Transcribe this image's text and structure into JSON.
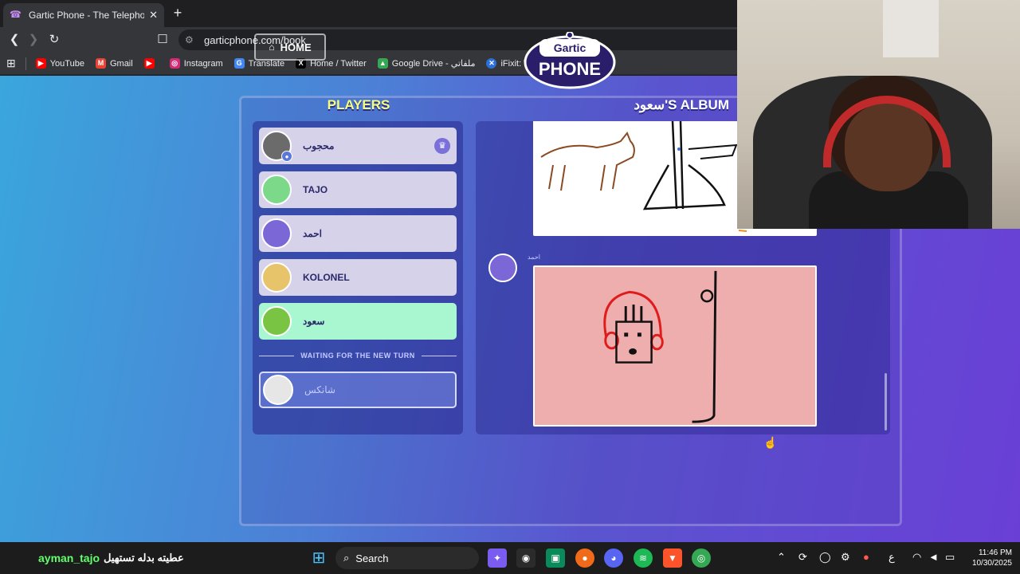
{
  "browser": {
    "tab_title": "Gartic Phone - The Telephone Ga",
    "url": "garticphone.com/book",
    "bookmarks": [
      {
        "label": "YouTube",
        "color": "#ff0000",
        "icon": "youtube-icon"
      },
      {
        "label": "Gmail",
        "color": "#ea4335",
        "icon": "gmail-icon"
      },
      {
        "label": "",
        "color": "#ff0000",
        "icon": "youtube-icon"
      },
      {
        "label": "Instagram",
        "color": "#d62976",
        "icon": "instagram-icon"
      },
      {
        "label": "Translate",
        "color": "#4285f4",
        "icon": "translate-icon"
      },
      {
        "label": "Home / Twitter",
        "color": "#000000",
        "icon": "x-icon"
      },
      {
        "label": "Google Drive - ملفاتي",
        "color": "#34a853",
        "icon": "drive-icon"
      },
      {
        "label": "iFixit: The Free Repa...",
        "color": "#2a6fdb",
        "icon": "ifixit-icon"
      }
    ]
  },
  "game": {
    "home_label": "HOME",
    "logo_top": "Gartic",
    "logo_bottom": "PHONE",
    "players_title": "PLAYERS",
    "album_title": "سعود'S ALBUM",
    "players": [
      {
        "name": "محجوب",
        "color": "#6b6b6b",
        "host": true
      },
      {
        "name": "TAJO",
        "color": "#7dd98a",
        "host": false
      },
      {
        "name": "احمد",
        "color": "#7b67d6",
        "host": false
      },
      {
        "name": "KOLONEL",
        "color": "#e7c36a",
        "host": false
      },
      {
        "name": "سعود",
        "color": "#79c443",
        "host": false
      }
    ],
    "waiting_label": "WAITING FOR THE NEW TURN",
    "waiting_players": [
      {
        "name": "شانكس",
        "color": "#e6e6e6"
      }
    ],
    "album_entry_author": "احمد"
  },
  "taskbar": {
    "stream_user": "ayman_tajo",
    "stream_message": "عطيته بدله تستهيل",
    "search_label": "Search",
    "lang": "ع",
    "time": "11:46 PM",
    "date": "10/30/2025"
  }
}
